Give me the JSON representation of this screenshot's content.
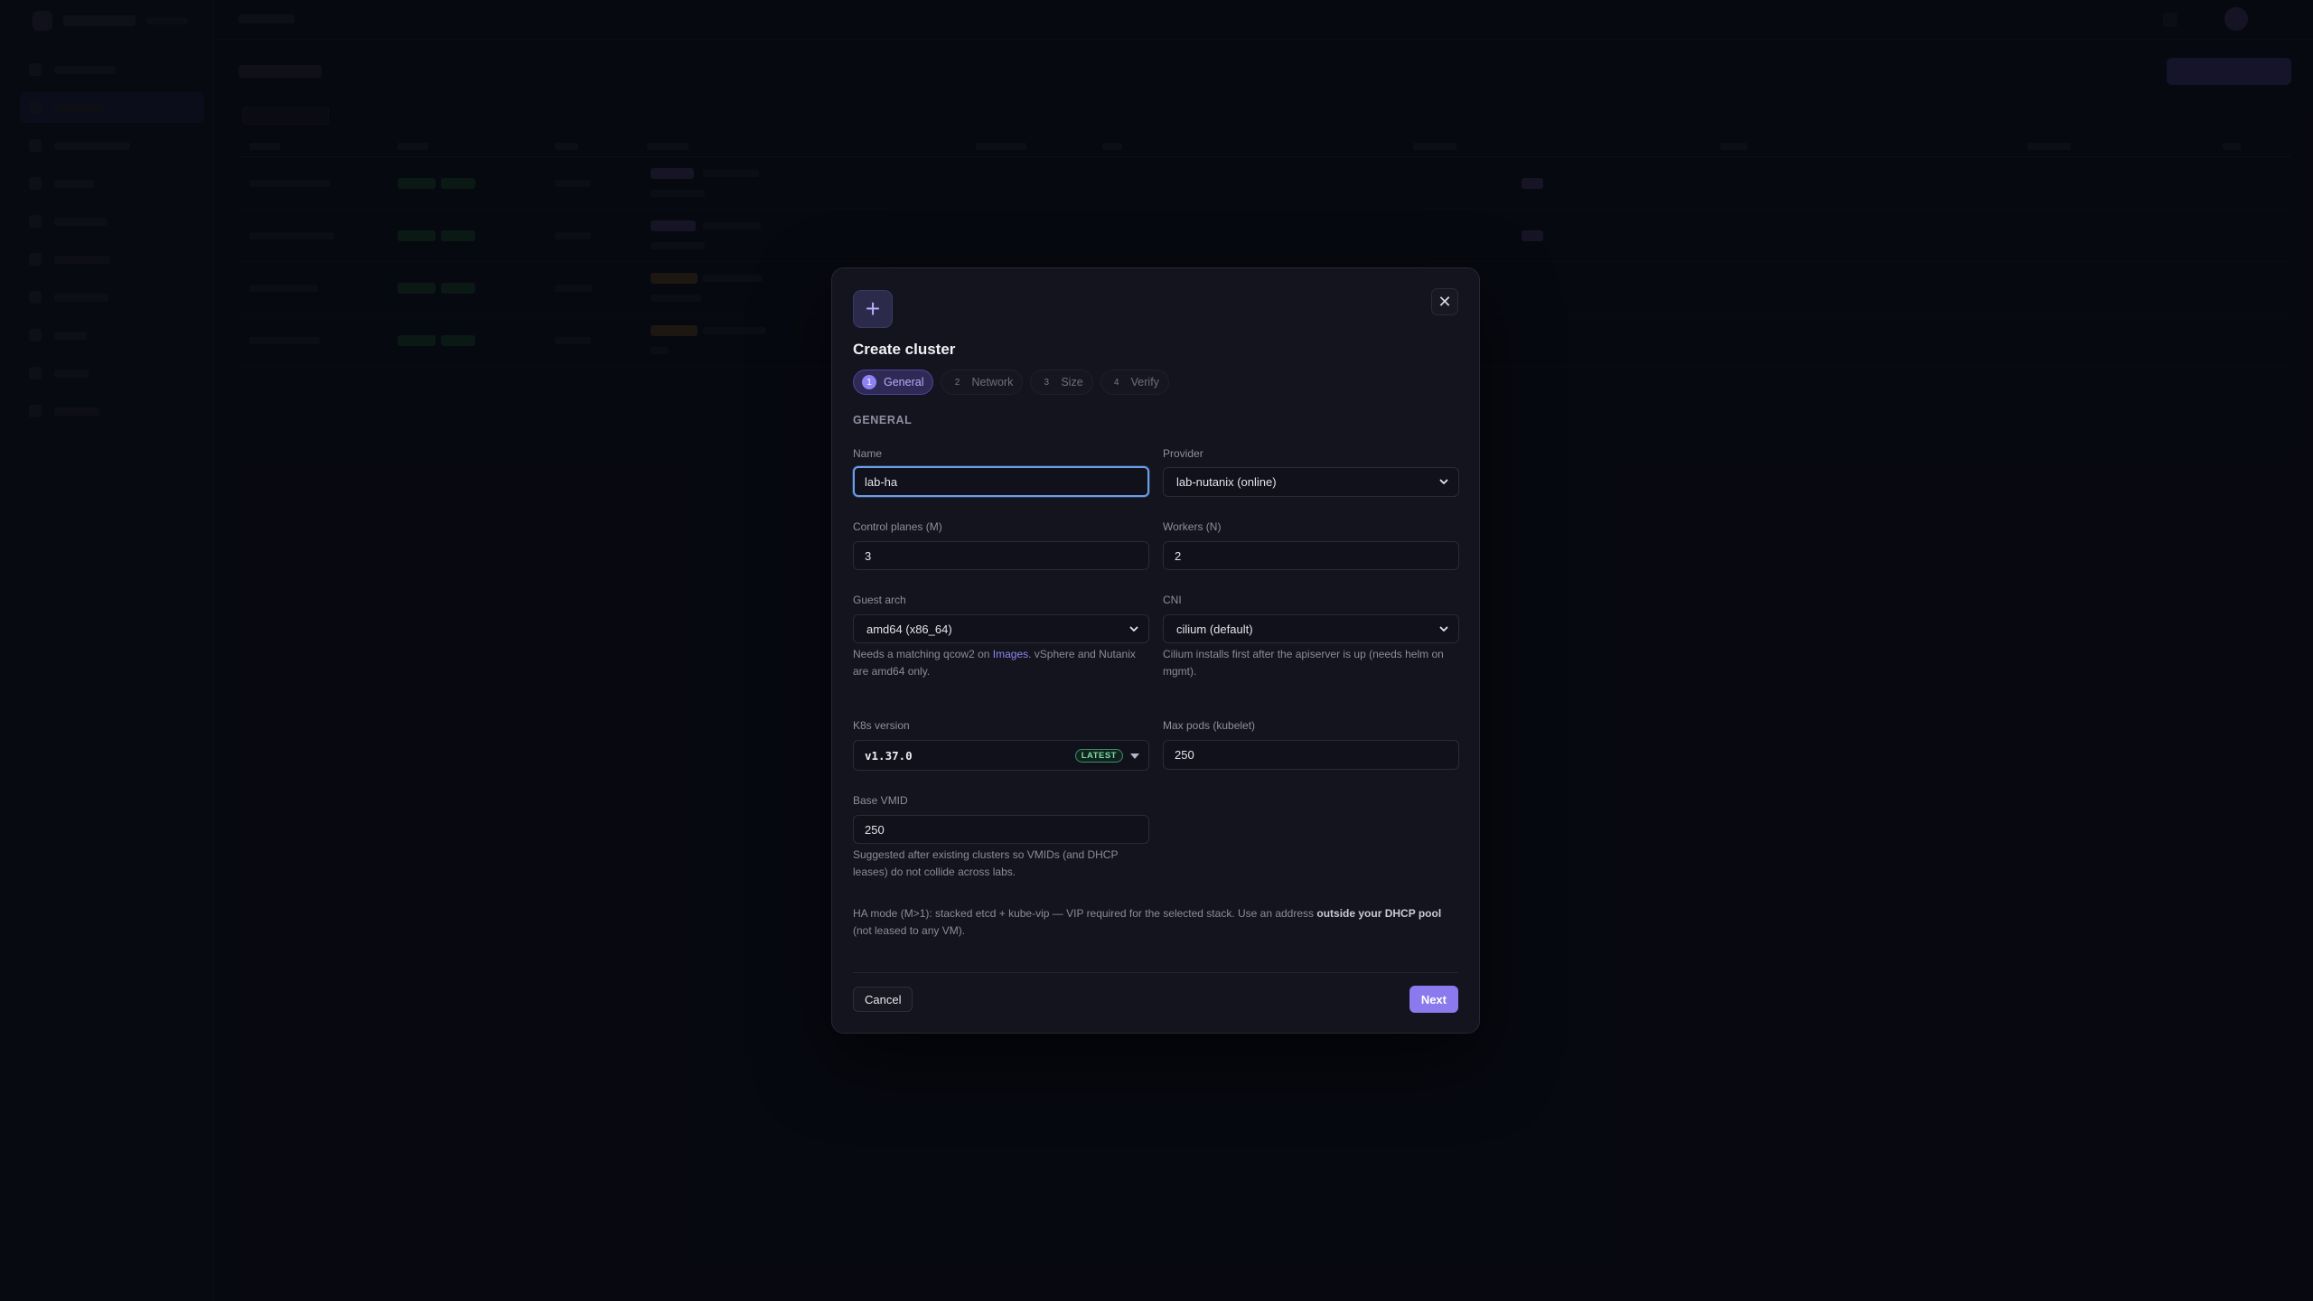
{
  "modal": {
    "title": "Create cluster",
    "add_icon": "plus-icon",
    "close_icon": "close-icon",
    "steps": [
      {
        "num": "1",
        "label": "General",
        "active": true
      },
      {
        "num": "2",
        "label": "Network",
        "active": false
      },
      {
        "num": "3",
        "label": "Size",
        "active": false
      },
      {
        "num": "4",
        "label": "Verify",
        "active": false
      }
    ],
    "section": "GENERAL",
    "fields": {
      "name": {
        "label": "Name",
        "value": "lab-ha"
      },
      "provider": {
        "label": "Provider",
        "value": "lab-nutanix (online)"
      },
      "control_planes": {
        "label": "Control planes (M)",
        "value": "3"
      },
      "workers": {
        "label": "Workers (N)",
        "value": "2"
      },
      "guest_arch": {
        "label": "Guest arch",
        "value": "amd64 (x86_64)",
        "help_before": "Needs a matching qcow2 on ",
        "help_link": "Images",
        "help_after": ". vSphere and Nutanix are amd64 only."
      },
      "cni": {
        "label": "CNI",
        "value": "cilium (default)",
        "help": "Cilium installs first after the apiserver is up (needs helm on mgmt)."
      },
      "k8s_version": {
        "label": "K8s version",
        "value": "v1.37.0",
        "badge": "LATEST"
      },
      "max_pods": {
        "label": "Max pods (kubelet)",
        "value": "250"
      },
      "base_vmid": {
        "label": "Base VMID",
        "value": "250",
        "help": "Suggested after existing clusters so VMIDs (and DHCP leases) do not collide across labs."
      }
    },
    "ha_note": {
      "before": "HA mode (M>1): stacked etcd + kube-vip — VIP required for the selected stack. Use an address ",
      "bold": "outside your DHCP pool",
      "after": " (not leased to any VM)."
    },
    "cancel_label": "Cancel",
    "next_label": "Next"
  },
  "colors": {
    "accent": "#8b79ee",
    "focus_ring": "#6b9ee8",
    "latest_badge": "#7fd9a8",
    "background": "#0b0c14",
    "modal": "#13141d"
  }
}
